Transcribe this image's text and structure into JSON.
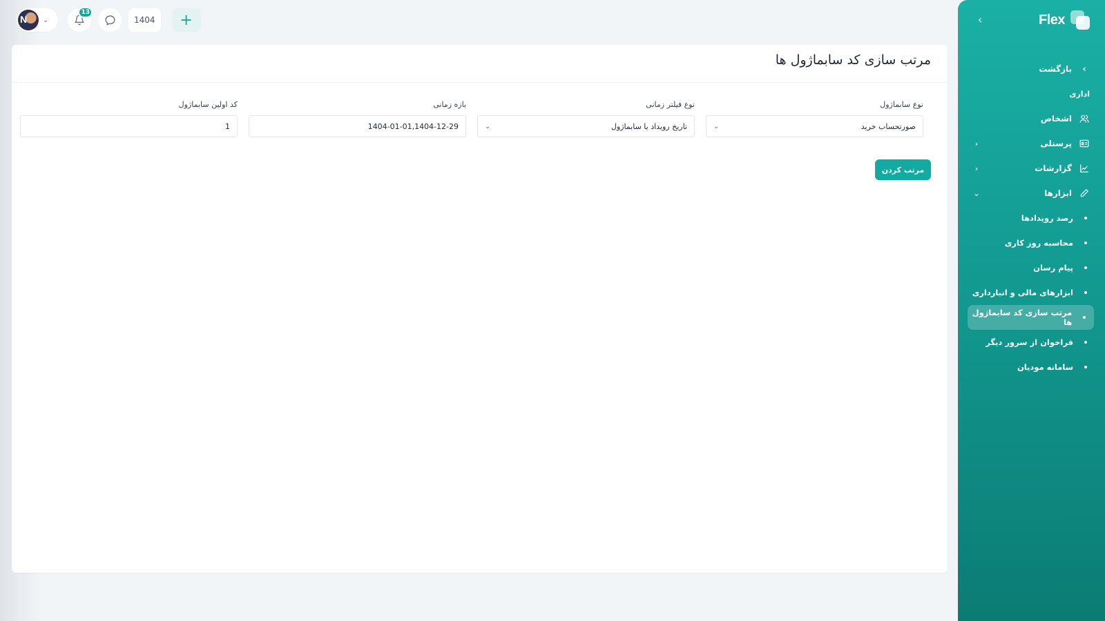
{
  "colors": {
    "accent": "#13a89e",
    "sidebar_top": "#1ab0a6",
    "sidebar_bottom": "#0b7c74",
    "page_bg": "#f2f5f7"
  },
  "topbar": {
    "notification_count": "13",
    "year": "1404",
    "add_symbol": "+"
  },
  "sidebar": {
    "brand": "Flex",
    "collapse_symbol": "‹",
    "back_label": "بازگشت",
    "section_label": "اداری",
    "items": [
      {
        "label": "اشخاص",
        "icon": "people-icon",
        "arrow": ""
      },
      {
        "label": "پرسنلی",
        "icon": "id-card-icon",
        "arrow": "‹"
      },
      {
        "label": "گزارشات",
        "icon": "line-chart-icon",
        "arrow": "‹"
      },
      {
        "label": "ابزارها",
        "icon": "pencil-icon",
        "arrow": "⌄"
      }
    ],
    "subitems": [
      "رصد رویدادها",
      "محاسبه روز کاری",
      "پیام رسان",
      "ابزارهای مالی و انبارداری",
      "مرتب سازی کد سابماژول ها",
      "فراخوان از سرور دیگر",
      "سامانه مودیان"
    ],
    "active_subitem": "مرتب سازی کد سابماژول ها"
  },
  "page": {
    "title": "مرتب سازی کد سابماژول ها",
    "fields": {
      "submodule_type": {
        "label": "نوع سابماژول",
        "value": "صورتحساب خرید"
      },
      "time_filter_type": {
        "label": "نوع فیلتر زمانی",
        "value": "تاریخ رویداد یا سابماژول"
      },
      "time_range": {
        "label": "بازه زمانی",
        "value": "1404-01-01,1404-12-29"
      },
      "first_code": {
        "label": "کد اولین سابماژول",
        "value": "1"
      }
    },
    "sort_button": "مرتب کردن"
  }
}
